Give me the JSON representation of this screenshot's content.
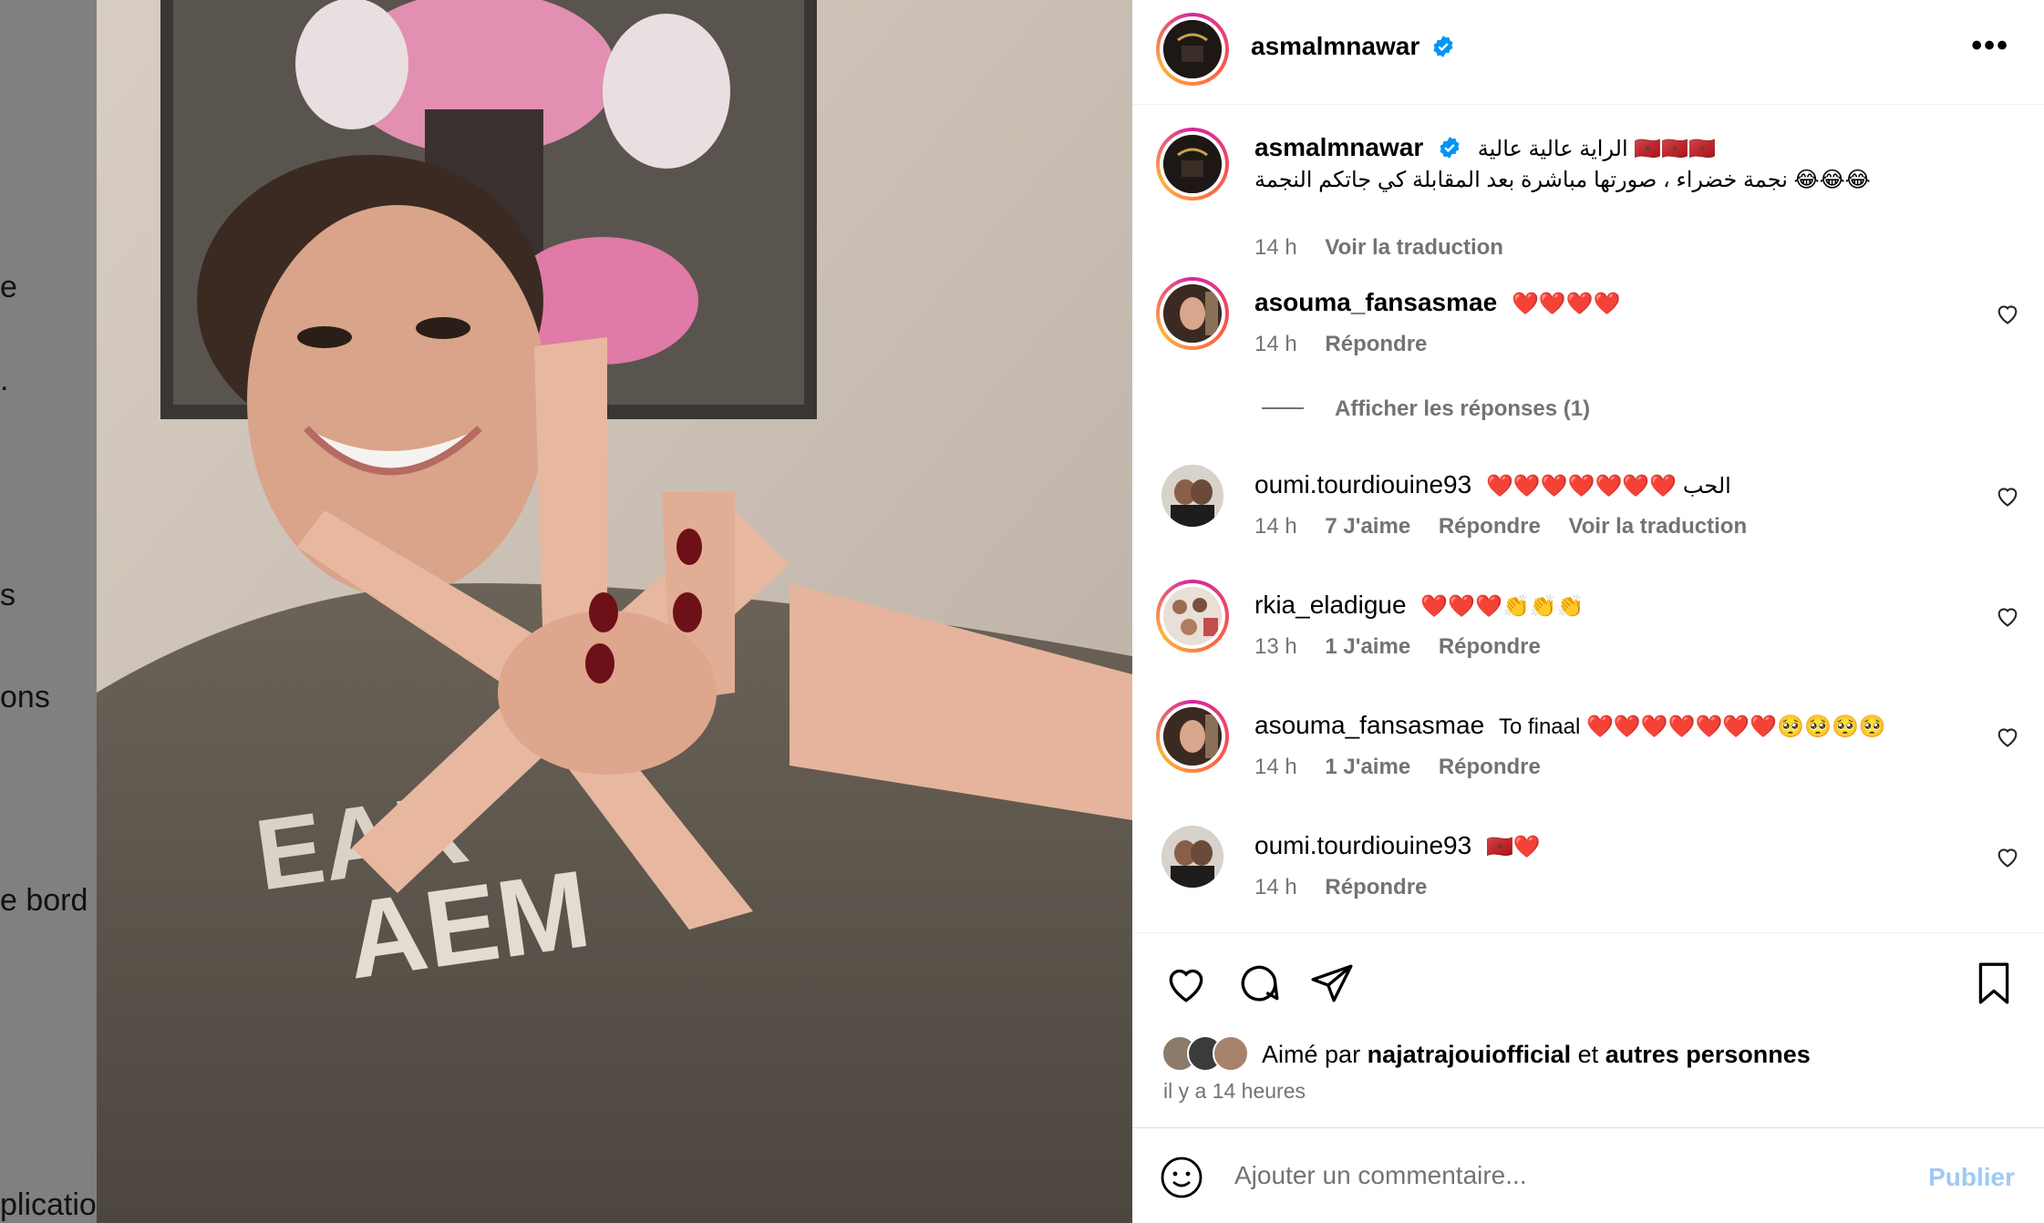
{
  "sidebar": {
    "fragments": [
      "e",
      ".",
      "s",
      "ons",
      "e bord",
      "plicatio"
    ]
  },
  "post": {
    "author": "asmalmnawar",
    "more_icon": "more-horizontal-icon",
    "caption_line1": "الراية عالية عالية 🇲🇦🇲🇦🇲🇦",
    "caption_line2": "نجمة خضراء ، صورتها مباشرة بعد المقابلة كي جاتكم النجمة 😂😂😂",
    "caption_time": "14 h",
    "caption_translate": "Voir la traduction"
  },
  "comments": [
    {
      "user": "asouma_fansasmae",
      "text": "❤️❤️❤️❤️",
      "time": "14 h",
      "likes": "",
      "reply": "Répondre",
      "translate": ""
    },
    {
      "user": "oumi.tourdiouine93",
      "text": "❤️❤️❤️❤️❤️❤️❤️ الحب",
      "time": "14 h",
      "likes": "7 J'aime",
      "reply": "Répondre",
      "translate": "Voir la traduction"
    },
    {
      "user": "rkia_eladigue",
      "text": "❤️❤️❤️👏👏👏",
      "time": "13 h",
      "likes": "1 J'aime",
      "reply": "Répondre",
      "translate": ""
    },
    {
      "user": "asouma_fansasmae",
      "text": "To finaal ❤️❤️❤️❤️❤️❤️❤️🥺🥺🥺🥺",
      "time": "14 h",
      "likes": "1 J'aime",
      "reply": "Répondre",
      "translate": ""
    },
    {
      "user": "oumi.tourdiouine93",
      "text": "🇲🇦❤️",
      "time": "14 h",
      "likes": "",
      "reply": "Répondre",
      "translate": ""
    }
  ],
  "view_replies": "Afficher les réponses (1)",
  "likes": {
    "prefix": "Aimé par",
    "user": "najatrajouiofficial",
    "joiner": "et",
    "others": "autres personnes",
    "ago": "il y a 14 heures"
  },
  "composer": {
    "placeholder": "Ajouter un commentaire...",
    "publish": "Publier"
  },
  "colors": {
    "verified": "#0095f6",
    "muted": "#737373",
    "publish_disabled": "#9fc9f5"
  }
}
